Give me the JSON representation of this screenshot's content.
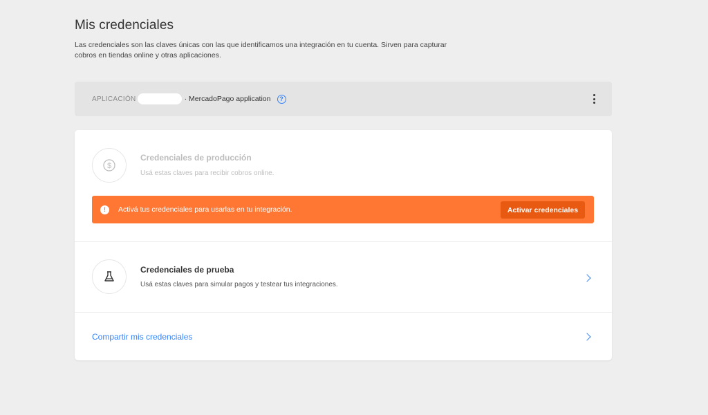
{
  "header": {
    "title": "Mis credenciales",
    "description": "Las credenciales son las claves únicas con las que identificamos una integración en tu cuenta. Sirven para capturar cobros en tiendas online y otras aplicaciones."
  },
  "app_bar": {
    "label": "APLICACIÓN",
    "app_name": "· MercadoPago application",
    "help_icon": "question-circle-icon",
    "menu_icon": "kebab-menu-icon"
  },
  "production": {
    "icon": "dollar-coin-icon",
    "title": "Credenciales de producción",
    "description": "Usá estas claves para recibir cobros online."
  },
  "alert": {
    "icon": "exclamation-icon",
    "text": "Activá tus credenciales para usarlas en tu integración.",
    "button_label": "Activar credenciales",
    "color": "#ff7733",
    "button_color": "#e85a12"
  },
  "test": {
    "icon": "flask-icon",
    "title": "Credenciales de prueba",
    "description": "Usá estas claves para simular pagos y testear tus integraciones."
  },
  "share": {
    "label": "Compartir mis credenciales"
  },
  "colors": {
    "accent": "#3483fa",
    "background": "#eeeeee"
  }
}
